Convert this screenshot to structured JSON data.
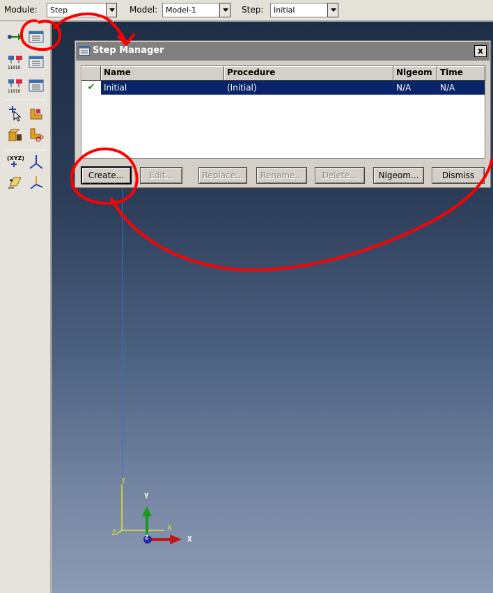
{
  "context_bar": {
    "module_label": "Module:",
    "module_value": "Step",
    "model_label": "Model:",
    "model_value": "Model-1",
    "step_label": "Step:",
    "step_value": "Initial"
  },
  "toolbox": {
    "xyz_label": "(XYZ)"
  },
  "dialog": {
    "title": "Step Manager",
    "close_label": "x",
    "columns": [
      "Name",
      "Procedure",
      "Nlgeom",
      "Time"
    ],
    "rows": [
      {
        "check": "✔",
        "name": "Initial",
        "procedure": "(Initial)",
        "nlgeom": "N/A",
        "time": "N/A"
      }
    ],
    "buttons": {
      "create": "Create...",
      "edit": "Edit...",
      "replace": "Replace...",
      "rename": "Rename...",
      "delete": "Delete...",
      "nlgeom": "Nlgeom...",
      "dismiss": "Dismiss"
    }
  },
  "triad": {
    "global_y": "Y",
    "global_x": "X",
    "global_z": "Z",
    "view_y": "Y",
    "view_x": "X",
    "view_z": "Z"
  },
  "colors": {
    "selection": "#0a246a",
    "annotation": "#ff0000",
    "check": "#1a8a1a"
  }
}
